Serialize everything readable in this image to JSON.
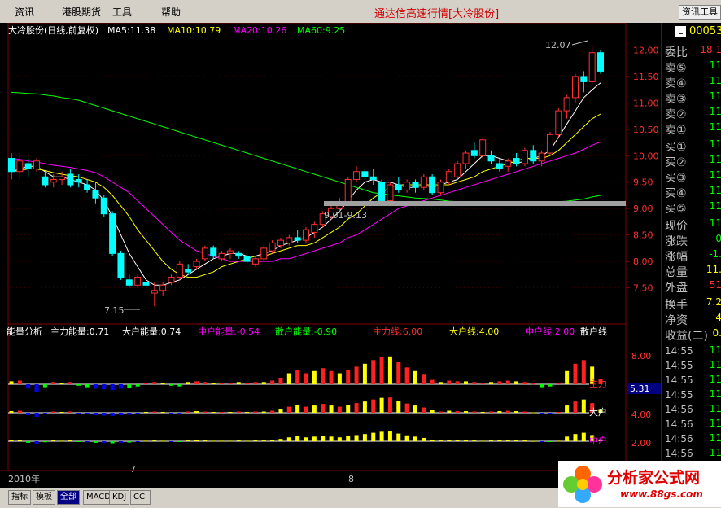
{
  "menu": {
    "items": [
      "资讯",
      "港股期货",
      "工具",
      "帮助"
    ]
  },
  "app_title": "通达信高速行情[大冷股份]",
  "info_button": "资讯工具",
  "main_chart": {
    "title": "大冷股份(日线,前复权)",
    "ma": [
      {
        "label": "MA5:11.38",
        "color": "#ffffff"
      },
      {
        "label": "MA10:10.79",
        "color": "#ffff00"
      },
      {
        "label": "MA20:10.26",
        "color": "#ff00ff"
      },
      {
        "label": "MA60:9.25",
        "color": "#00ff00"
      }
    ],
    "price_ticks": [
      "12.00",
      "11.50",
      "11.00",
      "10.50",
      "10.00",
      "9.50",
      "9.00",
      "8.50",
      "8.00",
      "7.50"
    ],
    "annotations": {
      "high": "12.07",
      "low": "7.15",
      "range": "9.01-9.13"
    }
  },
  "indicator": {
    "title": "能量分析",
    "items": [
      {
        "label": "主力能量:0.71",
        "color": "#ffffff"
      },
      {
        "label": "大户能量:0.74",
        "color": "#ffffff"
      },
      {
        "label": "中户能量:-0.54",
        "color": "#ff00ff"
      },
      {
        "label": "散户能量:-0.90",
        "color": "#00ff00"
      },
      {
        "label": "主力线:6.00",
        "color": "#ff3030"
      },
      {
        "label": "大户线:4.00",
        "color": "#ffff00"
      },
      {
        "label": "中户线:2.00",
        "color": "#ff00ff"
      },
      {
        "label": "散户线",
        "color": "#ffffff"
      }
    ],
    "ticks": [
      "8.00",
      "6.00",
      "4.00",
      "2.00"
    ],
    "line_labels": [
      "主力",
      "大户",
      "中户"
    ],
    "cursor_value": "5.31"
  },
  "date_axis": {
    "labels": [
      "2010年",
      "7",
      "8"
    ]
  },
  "right_panel": {
    "code": "00053",
    "badge": "L",
    "rows": [
      {
        "label": "委比",
        "value": "18.1",
        "color": "#ff3030"
      },
      {
        "label": "卖⑤",
        "value": "11",
        "color": "#00ff00"
      },
      {
        "label": "卖④",
        "value": "11",
        "color": "#00ff00"
      },
      {
        "label": "卖③",
        "value": "11",
        "color": "#00ff00"
      },
      {
        "label": "卖②",
        "value": "11",
        "color": "#00ff00"
      },
      {
        "label": "卖①",
        "value": "11",
        "color": "#00ff00"
      },
      {
        "label": "买①",
        "value": "11",
        "color": "#00ff00"
      },
      {
        "label": "买②",
        "value": "11",
        "color": "#00ff00"
      },
      {
        "label": "买③",
        "value": "11",
        "color": "#00ff00"
      },
      {
        "label": "买④",
        "value": "11",
        "color": "#00ff00"
      },
      {
        "label": "买⑤",
        "value": "11",
        "color": "#00ff00"
      },
      {
        "label": "现价",
        "value": "11",
        "color": "#00ff00"
      },
      {
        "label": "涨跌",
        "value": "-0",
        "color": "#00ff00"
      },
      {
        "label": "涨幅",
        "value": "-1.",
        "color": "#00ff00"
      },
      {
        "label": "总量",
        "value": "11.",
        "color": "#ffff00"
      },
      {
        "label": "外盘",
        "value": "51",
        "color": "#ff3030"
      },
      {
        "label": "换手",
        "value": "7.2",
        "color": "#ffff00"
      },
      {
        "label": "净资",
        "value": "4",
        "color": "#ffff00"
      },
      {
        "label": "收益(二)",
        "value": "0.",
        "color": "#ffff00"
      },
      {
        "label": "14:55",
        "value": "11",
        "color": "#00ff00"
      },
      {
        "label": "14:55",
        "value": "11",
        "color": "#00ff00"
      },
      {
        "label": "14:55",
        "value": "11",
        "color": "#00ff00"
      },
      {
        "label": "14:55",
        "value": "11",
        "color": "#00ff00"
      },
      {
        "label": "14:56",
        "value": "11",
        "color": "#00ff00"
      },
      {
        "label": "14:56",
        "value": "11",
        "color": "#00ff00"
      },
      {
        "label": "14:56",
        "value": "11",
        "color": "#00ff00"
      },
      {
        "label": "14:56",
        "value": "11",
        "color": "#00ff00"
      },
      {
        "label": "14:56",
        "value": "11",
        "color": "#00ff00"
      },
      {
        "label": "14:56",
        "value": "11",
        "color": "#00ff00"
      }
    ]
  },
  "bottom_tabs": [
    "指标",
    "模板",
    "全部",
    "MACD",
    "KDJ",
    "CCI"
  ],
  "logo": {
    "text": "分析家公式网",
    "url_text": "www.88gs.com"
  },
  "chart_data": {
    "type": "candlestick",
    "ohlc": [
      [
        9.95,
        10.05,
        9.55,
        9.7
      ],
      [
        9.7,
        10.05,
        9.55,
        9.9
      ],
      [
        9.85,
        9.95,
        9.6,
        9.75
      ],
      [
        9.75,
        9.95,
        9.7,
        9.9
      ],
      [
        9.6,
        9.7,
        9.4,
        9.45
      ],
      [
        9.5,
        9.65,
        9.4,
        9.55
      ],
      [
        9.55,
        9.7,
        9.45,
        9.6
      ],
      [
        9.65,
        9.75,
        9.4,
        9.45
      ],
      [
        9.55,
        9.65,
        9.4,
        9.5
      ],
      [
        9.45,
        9.55,
        9.3,
        9.35
      ],
      [
        9.35,
        9.5,
        9.1,
        9.2
      ],
      [
        9.2,
        9.25,
        8.85,
        8.9
      ],
      [
        8.9,
        8.95,
        8.1,
        8.15
      ],
      [
        8.15,
        8.2,
        7.65,
        7.7
      ],
      [
        7.65,
        7.75,
        7.5,
        7.55
      ],
      [
        7.55,
        7.75,
        7.5,
        7.7
      ],
      [
        7.6,
        7.7,
        7.45,
        7.55
      ],
      [
        7.4,
        7.6,
        7.15,
        7.45
      ],
      [
        7.45,
        7.6,
        7.35,
        7.55
      ],
      [
        7.6,
        7.75,
        7.55,
        7.7
      ],
      [
        7.7,
        8.0,
        7.65,
        7.95
      ],
      [
        7.85,
        7.95,
        7.75,
        7.8
      ],
      [
        7.9,
        8.05,
        7.85,
        8.0
      ],
      [
        8.05,
        8.3,
        8.0,
        8.25
      ],
      [
        8.25,
        8.3,
        8.05,
        8.1
      ],
      [
        8.05,
        8.2,
        8.0,
        8.15
      ],
      [
        8.15,
        8.25,
        8.05,
        8.2
      ],
      [
        8.15,
        8.2,
        8.05,
        8.1
      ],
      [
        8.1,
        8.15,
        7.95,
        8.0
      ],
      [
        7.95,
        8.1,
        7.9,
        8.05
      ],
      [
        8.05,
        8.3,
        8.0,
        8.25
      ],
      [
        8.2,
        8.4,
        8.15,
        8.35
      ],
      [
        8.3,
        8.45,
        8.25,
        8.4
      ],
      [
        8.35,
        8.5,
        8.3,
        8.45
      ],
      [
        8.45,
        8.6,
        8.35,
        8.4
      ],
      [
        8.4,
        8.65,
        8.35,
        8.6
      ],
      [
        8.55,
        8.75,
        8.45,
        8.7
      ],
      [
        8.7,
        8.95,
        8.65,
        8.9
      ],
      [
        8.85,
        9.05,
        8.8,
        9.0
      ],
      [
        9.0,
        9.2,
        8.95,
        9.1
      ],
      [
        9.1,
        9.6,
        9.05,
        9.55
      ],
      [
        9.55,
        9.8,
        9.5,
        9.7
      ],
      [
        9.7,
        9.75,
        9.55,
        9.6
      ],
      [
        9.6,
        9.75,
        9.45,
        9.55
      ],
      [
        9.5,
        9.55,
        9.05,
        9.15
      ],
      [
        9.15,
        9.5,
        9.1,
        9.45
      ],
      [
        9.45,
        9.6,
        9.3,
        9.35
      ],
      [
        9.35,
        9.55,
        9.3,
        9.5
      ],
      [
        9.5,
        9.55,
        9.3,
        9.4
      ],
      [
        9.4,
        9.65,
        9.35,
        9.6
      ],
      [
        9.6,
        9.65,
        9.25,
        9.3
      ],
      [
        9.3,
        9.55,
        9.25,
        9.5
      ],
      [
        9.5,
        9.75,
        9.45,
        9.7
      ],
      [
        9.6,
        9.9,
        9.55,
        9.85
      ],
      [
        9.85,
        10.1,
        9.75,
        10.05
      ],
      [
        10.1,
        10.25,
        9.95,
        10.0
      ],
      [
        10.0,
        10.35,
        9.95,
        10.3
      ],
      [
        10.0,
        10.1,
        9.85,
        9.9
      ],
      [
        9.85,
        9.95,
        9.7,
        9.75
      ],
      [
        9.8,
        9.95,
        9.7,
        9.9
      ],
      [
        9.95,
        10.05,
        9.8,
        9.85
      ],
      [
        9.85,
        10.15,
        9.8,
        10.1
      ],
      [
        10.1,
        10.2,
        9.85,
        9.9
      ],
      [
        9.9,
        10.1,
        9.8,
        10.05
      ],
      [
        10.05,
        10.45,
        10.0,
        10.4
      ],
      [
        10.4,
        10.9,
        10.35,
        10.85
      ],
      [
        10.85,
        11.15,
        10.7,
        11.1
      ],
      [
        11.1,
        11.55,
        11.0,
        11.5
      ],
      [
        11.5,
        11.6,
        11.2,
        11.4
      ],
      [
        11.4,
        12.07,
        11.35,
        11.95
      ],
      [
        11.95,
        12.0,
        11.55,
        11.6
      ]
    ],
    "ma": {
      "MA5": [
        9.7,
        9.75,
        9.8,
        9.8,
        9.7,
        9.6,
        9.6,
        9.55,
        9.5,
        9.45,
        9.35,
        9.15,
        8.85,
        8.5,
        8.15,
        7.9,
        7.65,
        7.55,
        7.55,
        7.6,
        7.65,
        7.75,
        7.85,
        7.95,
        8.05,
        8.1,
        8.15,
        8.15,
        8.1,
        8.1,
        8.15,
        8.2,
        8.3,
        8.35,
        8.4,
        8.45,
        8.55,
        8.65,
        8.8,
        8.95,
        9.15,
        9.35,
        9.5,
        9.55,
        9.5,
        9.5,
        9.45,
        9.4,
        9.4,
        9.45,
        9.4,
        9.45,
        9.5,
        9.55,
        9.7,
        9.85,
        10.0,
        10.0,
        9.95,
        9.9,
        9.85,
        9.9,
        9.95,
        10.0,
        10.1,
        10.35,
        10.6,
        10.85,
        11.1,
        11.25,
        11.38
      ],
      "MA10": [
        9.7,
        9.72,
        9.75,
        9.75,
        9.72,
        9.68,
        9.65,
        9.62,
        9.6,
        9.55,
        9.5,
        9.4,
        9.25,
        9.05,
        8.85,
        8.6,
        8.4,
        8.2,
        8.0,
        7.85,
        7.75,
        7.7,
        7.7,
        7.75,
        7.8,
        7.9,
        7.95,
        8.0,
        8.05,
        8.1,
        8.1,
        8.15,
        8.2,
        8.25,
        8.3,
        8.3,
        8.35,
        8.45,
        8.55,
        8.65,
        8.8,
        8.9,
        9.05,
        9.2,
        9.3,
        9.4,
        9.45,
        9.45,
        9.45,
        9.45,
        9.45,
        9.45,
        9.45,
        9.5,
        9.55,
        9.6,
        9.7,
        9.75,
        9.8,
        9.85,
        9.9,
        9.95,
        9.95,
        9.95,
        10.0,
        10.1,
        10.25,
        10.4,
        10.55,
        10.7,
        10.79
      ],
      "MA20": [
        9.95,
        9.93,
        9.9,
        9.88,
        9.85,
        9.82,
        9.8,
        9.78,
        9.75,
        9.72,
        9.68,
        9.6,
        9.5,
        9.4,
        9.3,
        9.15,
        9.0,
        8.85,
        8.7,
        8.55,
        8.4,
        8.3,
        8.2,
        8.15,
        8.1,
        8.05,
        8.0,
        8.0,
        8.0,
        8.0,
        8.0,
        8.0,
        8.05,
        8.05,
        8.1,
        8.15,
        8.2,
        8.25,
        8.3,
        8.35,
        8.45,
        8.5,
        8.6,
        8.7,
        8.8,
        8.9,
        9.0,
        9.05,
        9.1,
        9.15,
        9.2,
        9.25,
        9.3,
        9.35,
        9.4,
        9.45,
        9.5,
        9.55,
        9.6,
        9.65,
        9.7,
        9.75,
        9.8,
        9.85,
        9.9,
        9.95,
        10.0,
        10.05,
        10.12,
        10.2,
        10.26
      ],
      "MA60": [
        11.2,
        11.19,
        11.18,
        11.17,
        11.15,
        11.13,
        11.1,
        11.08,
        11.05,
        11.0,
        10.95,
        10.9,
        10.85,
        10.8,
        10.75,
        10.7,
        10.65,
        10.6,
        10.55,
        10.5,
        10.45,
        10.4,
        10.35,
        10.3,
        10.25,
        10.2,
        10.15,
        10.1,
        10.05,
        10.0,
        9.95,
        9.9,
        9.85,
        9.8,
        9.75,
        9.7,
        9.65,
        9.6,
        9.55,
        9.5,
        9.45,
        9.4,
        9.35,
        9.3,
        9.28,
        9.26,
        9.24,
        9.22,
        9.2,
        9.19,
        9.18,
        9.16,
        9.14,
        9.13,
        9.12,
        9.11,
        9.1,
        9.1,
        9.1,
        9.1,
        9.1,
        9.1,
        9.1,
        9.11,
        9.12,
        9.13,
        9.14,
        9.16,
        9.18,
        9.22,
        9.25
      ]
    },
    "energy_zhuli": [
      0.4,
      0.5,
      -0.6,
      -1.0,
      -0.4,
      0.3,
      0.2,
      0.3,
      -0.2,
      -0.4,
      -0.6,
      -0.7,
      -0.8,
      -0.6,
      -0.5,
      -0.3,
      0.2,
      0.3,
      0.2,
      -0.2,
      -0.3,
      0.3,
      0.4,
      0.3,
      0.2,
      0.2,
      0.2,
      0.3,
      0.2,
      0.3,
      0.3,
      0.5,
      0.9,
      1.5,
      2.0,
      1.5,
      1.8,
      2.2,
      1.8,
      1.5,
      1.9,
      2.4,
      2.8,
      3.3,
      3.7,
      3.8,
      3.0,
      2.3,
      1.8,
      1.3,
      0.6,
      0.3,
      0.5,
      0.4,
      0.4,
      0.3,
      0.2,
      0.3,
      0.4,
      0.5,
      0.4,
      0.3,
      0.1,
      -0.4,
      -0.3,
      0.2,
      1.8,
      2.8,
      3.3,
      2.4,
      0.71
    ],
    "ylim": [
      7.0,
      12.3
    ],
    "ylabel": ""
  }
}
